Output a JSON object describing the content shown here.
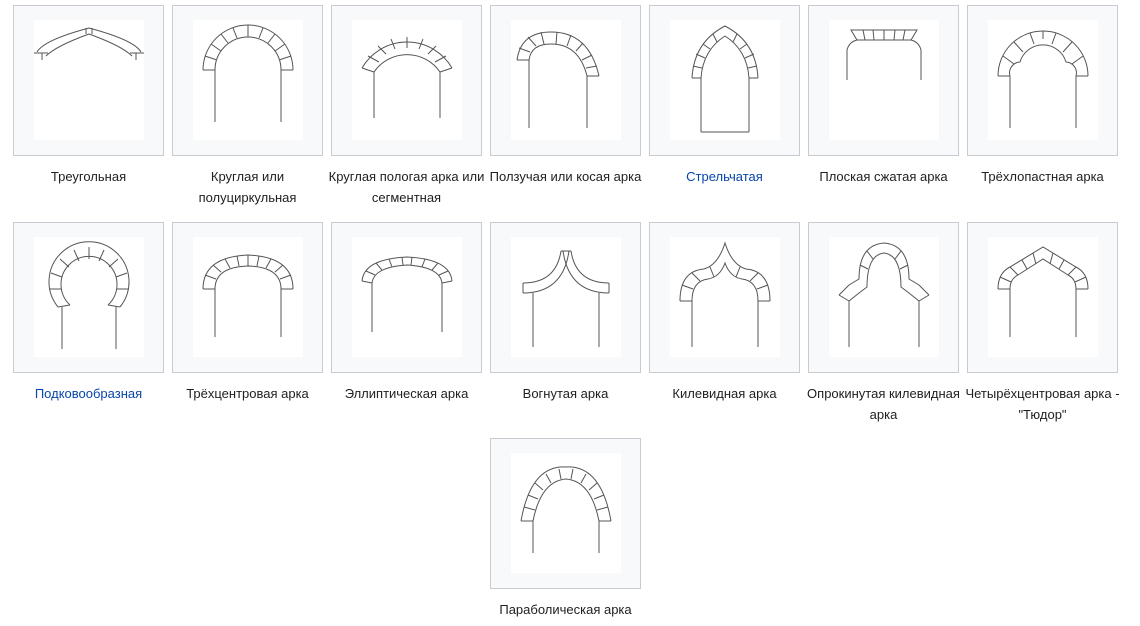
{
  "gallery": {
    "items": [
      {
        "name": "arch-triangular",
        "caption": "Треугольная",
        "link": false
      },
      {
        "name": "arch-round",
        "caption": "Круглая или полуциркульная",
        "link": false
      },
      {
        "name": "arch-segmental",
        "caption": "Круглая пологая арка или сегментная",
        "link": false
      },
      {
        "name": "arch-rampant",
        "caption": "Ползучая или косая арка",
        "link": false
      },
      {
        "name": "arch-pointed",
        "caption": "Стрельчатая",
        "link": true
      },
      {
        "name": "arch-flat",
        "caption": "Плоская сжатая арка",
        "link": false
      },
      {
        "name": "arch-trefoil",
        "caption": "Трёхлопастная арка",
        "link": false
      },
      {
        "name": "arch-horseshoe",
        "caption": "Подковообразная",
        "link": true
      },
      {
        "name": "arch-three-centered",
        "caption": "Трёхцентровая арка",
        "link": false
      },
      {
        "name": "arch-elliptical",
        "caption": "Эллиптическая арка",
        "link": false
      },
      {
        "name": "arch-concave",
        "caption": "Вогнутая арка",
        "link": false
      },
      {
        "name": "arch-ogee",
        "caption": "Килевидная арка",
        "link": false
      },
      {
        "name": "arch-inverted-ogee",
        "caption": "Опрокинутая килевидная арка",
        "link": false
      },
      {
        "name": "arch-tudor",
        "caption": "Четырёхцентровая арка - \"Тюдор\"",
        "link": false
      },
      {
        "name": "arch-parabolic",
        "caption": "Параболическая арка",
        "link": false
      }
    ]
  }
}
